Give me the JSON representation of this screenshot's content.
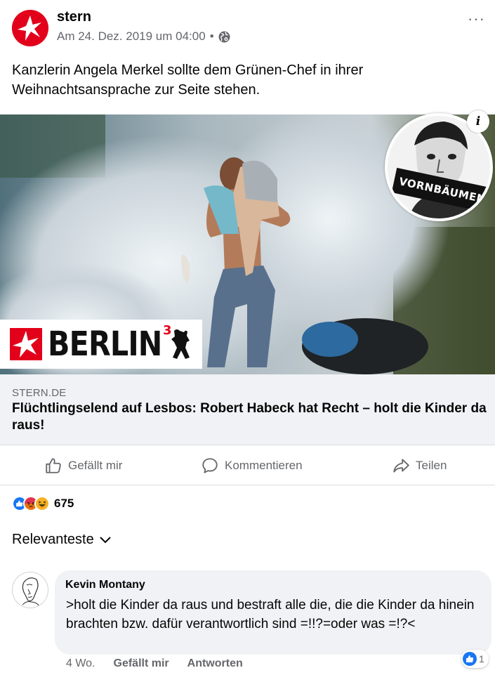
{
  "post": {
    "page_name": "stern",
    "timestamp": "Am 24. Dez. 2019 um 04:00",
    "meta_separator": "•",
    "privacy_icon": "globe-icon",
    "more_icon": "···",
    "text": "Kanzlerin Angela Merkel sollte dem Grünen-Chef in ihrer Weihnachtsansprache zur Seite stehen."
  },
  "media": {
    "info_icon": "i",
    "portrait_banner": "VORNBÄUMEN",
    "logo_word": "BERLIN",
    "logo_superscript": "3"
  },
  "link": {
    "domain": "STERN.DE",
    "title": "Flüchtlingselend auf Lesbos: Robert Habeck hat Recht – holt die Kinder da raus!"
  },
  "actions": {
    "like": "Gefällt mir",
    "comment": "Kommentieren",
    "share": "Teilen"
  },
  "reactions": {
    "icons": [
      "like",
      "angry",
      "haha"
    ],
    "count": "675"
  },
  "comments": {
    "sort_label": "Relevanteste",
    "items": [
      {
        "author": "Kevin Montany",
        "text": ">holt die Kinder da raus und bestraft alle die, die die Kinder da hinein brachten bzw. dafür verantwortlich sind =!!?=oder was =!?<",
        "time": "4 Wo.",
        "like_label": "Gefällt mir",
        "reply_label": "Antworten",
        "reaction_count": "1"
      }
    ]
  },
  "colors": {
    "stern_red": "#e2001a",
    "facebook_blue": "#1877f2",
    "muted_text": "#65676b",
    "link_background": "#f0f2f5"
  }
}
